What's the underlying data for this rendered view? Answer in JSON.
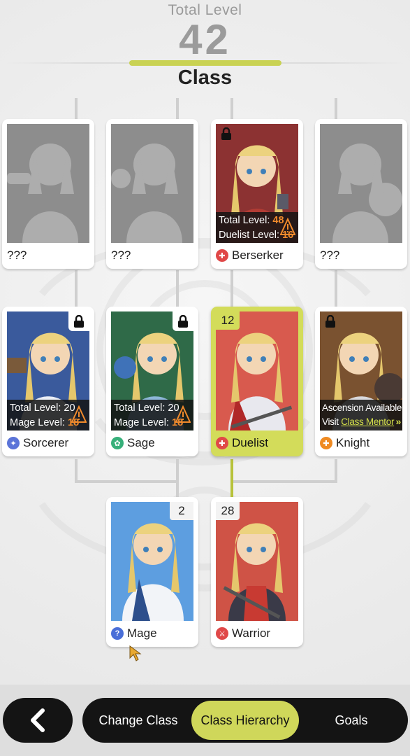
{
  "header": {
    "total_level_label": "Total Level",
    "total_level_value": "42",
    "title": "Class"
  },
  "classes": {
    "unknown1": {
      "name": "???"
    },
    "unknown2": {
      "name": "???"
    },
    "berserker": {
      "name": "Berserker",
      "req_total_label": "Total Level: ",
      "req_total_value": "48",
      "req_class_label": "Duelist Level: ",
      "req_class_value": "16"
    },
    "unknown3": {
      "name": "???"
    },
    "sorcerer": {
      "name": "Sorcerer",
      "req_total_label": "Total Level: ",
      "req_total_value": "20",
      "req_class_label": "Mage Level: ",
      "req_class_value": "18"
    },
    "sage": {
      "name": "Sage",
      "req_total_label": "Total Level: ",
      "req_total_value": "20",
      "req_class_label": "Mage Level: ",
      "req_class_value": "18"
    },
    "duelist": {
      "name": "Duelist",
      "level": "12"
    },
    "knight": {
      "name": "Knight",
      "ascension_text": "Ascension Available",
      "visit_text": "Visit ",
      "mentor_link": "Class Mentor",
      "chevrons": "»"
    },
    "mage": {
      "name": "Mage",
      "level": "2"
    },
    "warrior": {
      "name": "Warrior",
      "level": "28"
    }
  },
  "nav": {
    "back_icon": "chevron-left-icon",
    "tabs": [
      {
        "label": "Change Class"
      },
      {
        "label": "Class Hierarchy",
        "active": true
      },
      {
        "label": "Goals"
      }
    ]
  },
  "colors": {
    "accent": "#cfd75a",
    "warning": "#f08a2c",
    "berserker_bg": "#8c3232",
    "sorcerer_bg": "#3a5a9c",
    "sage_bg": "#2f6a48",
    "duelist_bg": "#d85a4e",
    "knight_bg": "#7a5230",
    "mage_bg": "#5d9ee0",
    "warrior_bg": "#cf5346",
    "locked_bg": "#8d8d8d"
  }
}
